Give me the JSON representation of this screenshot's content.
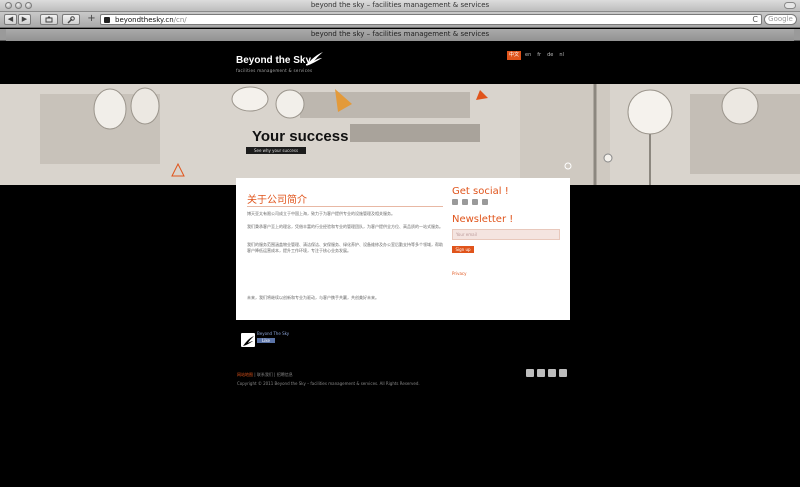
{
  "browser": {
    "window_title": "beyond the sky – facilities management & services",
    "tab_title": "beyond the sky – facilities management & services",
    "url_host": "beyondthesky.cn",
    "url_path": "/cn/",
    "reload_glyph": "C",
    "search_placeholder": "Google",
    "back_glyph": "◀",
    "forward_glyph": "▶",
    "new_tab_glyph": "+"
  },
  "header": {
    "logo_text": "Beyond the Sky",
    "logo_tagline": "facilities management & services",
    "languages": [
      "中文",
      "en",
      "fr",
      "de",
      "nl"
    ],
    "active_language": "中文"
  },
  "hero": {
    "title": "Your success",
    "button_label": "See why your success"
  },
  "about": {
    "title": "关于公司简介",
    "paragraphs": [
      "博天亚太有限公司成立于中国上海，致力于为客户提供专业的设施管理及相关服务。",
      "我们秉承客户至上的理念，凭借丰富的行业经验和专业的管理团队，为客户提供全方位、高品质的一站式服务。",
      "我们的服务范围涵盖物业管理、清洁保洁、安保服务、绿化养护、设备维修及办公室后勤支持等多个领域，帮助客户降低运营成本，提升工作环境，专注于核心业务发展。",
      "未来，我们将继续以创新和专业为驱动，与客户携手共赢，共创美好未来。"
    ]
  },
  "sidebar": {
    "social_heading": "Get social !",
    "social_icons": [
      "facebook-icon",
      "twitter-icon",
      "linkedin-icon",
      "rss-icon"
    ],
    "newsletter_heading": "Newsletter !",
    "email_placeholder": "Your email",
    "signup_label": "Sign up",
    "privacy_label": "Privacy"
  },
  "facebook": {
    "page_name": "Beyond The Sky",
    "like_label": "Like"
  },
  "footer": {
    "links_highlight": "网站地图",
    "links_rest": " | 联系我们 | 招聘信息",
    "copyright": "Copyright © 2011 Beyond the Sky – facilities management & services. All Rights Reserved.",
    "icons": [
      "play-icon",
      "square-icon",
      "square-icon",
      "play-icon"
    ]
  },
  "colors": {
    "accent": "#e0541b",
    "page_bg": "#000000",
    "panel_bg": "#ffffff"
  }
}
